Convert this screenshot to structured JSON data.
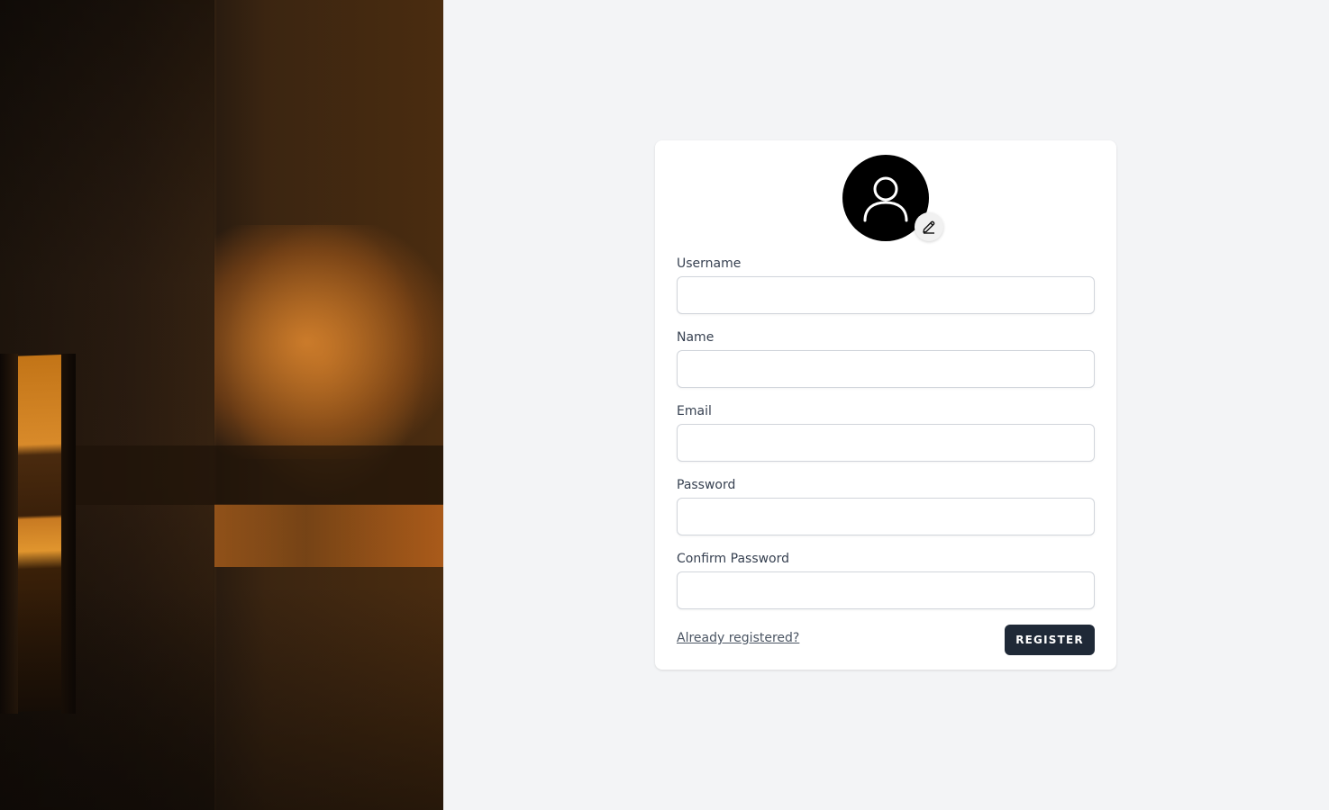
{
  "form": {
    "avatar_icon": "user-icon",
    "edit_icon": "pencil-icon",
    "fields": [
      {
        "label": "Username",
        "value": "",
        "placeholder": ""
      },
      {
        "label": "Name",
        "value": "",
        "placeholder": ""
      },
      {
        "label": "Email",
        "value": "",
        "placeholder": ""
      },
      {
        "label": "Password",
        "value": "",
        "placeholder": ""
      },
      {
        "label": "Confirm Password",
        "value": "",
        "placeholder": ""
      }
    ],
    "login_link": "Already registered?",
    "submit_label": "Register"
  },
  "colors": {
    "background": "#f3f4f6",
    "card": "#ffffff",
    "button": "#1f2937",
    "avatar": "#000000"
  }
}
